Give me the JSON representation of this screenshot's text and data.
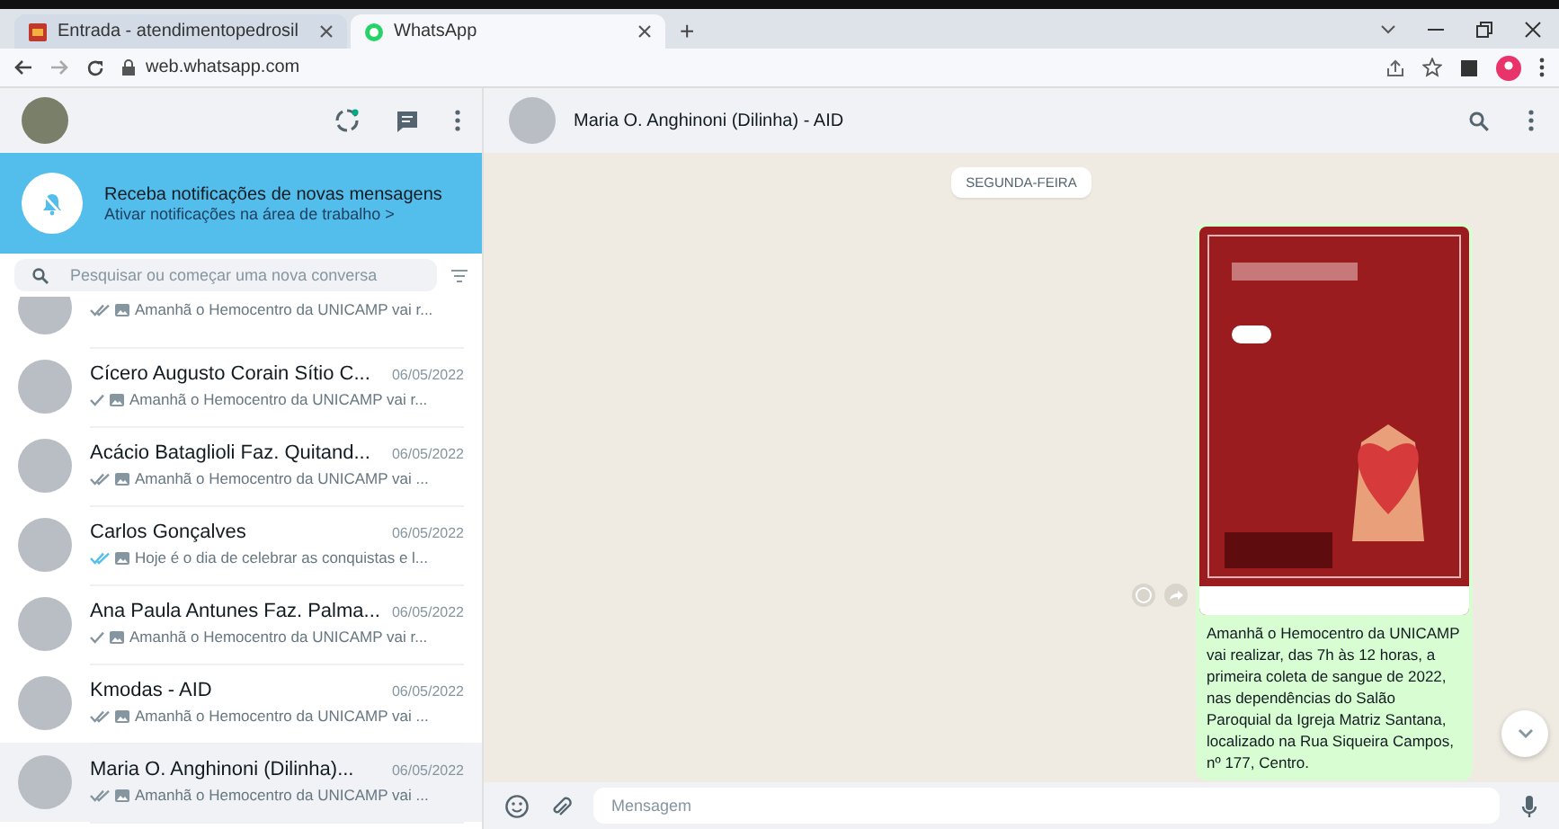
{
  "browser": {
    "tabs": [
      {
        "title": "Entrada - atendimentopedrosil",
        "selected": false
      },
      {
        "title": "WhatsApp",
        "selected": true
      }
    ],
    "new_tab": "+",
    "url": "web.whatsapp.com"
  },
  "notification_banner": {
    "title": "Receba notificações de novas mensagens",
    "link": "Ativar notificações na área de trabalho >"
  },
  "search": {
    "placeholder": "Pesquisar ou começar uma nova conversa"
  },
  "chats": [
    {
      "preview": "Amanhã o Hemocentro da UNICAMP vai r...",
      "double_tick": true,
      "read": false,
      "selected": false
    },
    {
      "name": "Cícero Augusto Corain Sítio C...",
      "date": "06/05/2022",
      "preview": "Amanhã o Hemocentro da UNICAMP vai r...",
      "double_tick": false,
      "read": false,
      "selected": false
    },
    {
      "name": "Acácio Bataglioli Faz. Quitand...",
      "date": "06/05/2022",
      "preview": "Amanhã o Hemocentro da UNICAMP vai ...",
      "double_tick": true,
      "read": false,
      "selected": false
    },
    {
      "name": "Carlos Gonçalves",
      "date": "06/05/2022",
      "preview": "Hoje é o dia de celebrar as conquistas e l...",
      "double_tick": true,
      "read": true,
      "selected": false
    },
    {
      "name": "Ana Paula Antunes Faz. Palma...",
      "date": "06/05/2022",
      "preview": "Amanhã o Hemocentro da UNICAMP vai r...",
      "double_tick": false,
      "read": false,
      "selected": false
    },
    {
      "name": "Kmodas - AID",
      "date": "06/05/2022",
      "preview": "Amanhã o Hemocentro da UNICAMP vai ...",
      "double_tick": true,
      "read": false,
      "selected": false
    },
    {
      "name": "Maria O. Anghinoni (Dilinha)...",
      "date": "06/05/2022",
      "preview": "Amanhã o Hemocentro da UNICAMP vai ...",
      "double_tick": true,
      "read": false,
      "selected": true
    }
  ],
  "conversation": {
    "contact": "Maria O. Anghinoni (Dilinha) - AID",
    "date_chip": "SEGUNDA-FEIRA",
    "message": {
      "text": "Amanhã o Hemocentro da UNICAMP vai realizar, das 7h às 12 horas, a primeira coleta de sangue de 2022, nas dependências do Salão Paroquial da Igreja Matriz Santana, localizado na Rua Siqueira Campos, nº 177, Centro."
    }
  },
  "composer": {
    "placeholder": "Mensagem"
  }
}
